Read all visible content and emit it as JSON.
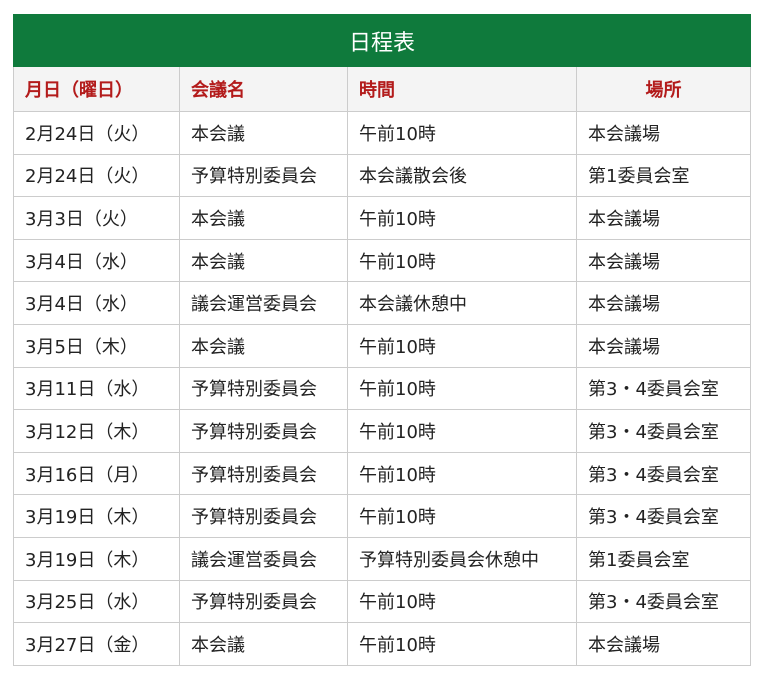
{
  "schedule": {
    "title": "日程表",
    "headers": {
      "date": "月日（曜日）",
      "meeting": "会議名",
      "time": "時間",
      "place": "場所"
    },
    "rows": [
      {
        "date": "2月24日（火）",
        "meeting": "本会議",
        "time": "午前10時",
        "place": "本会議場"
      },
      {
        "date": "2月24日（火）",
        "meeting": "予算特別委員会",
        "time": "本会議散会後",
        "place": "第1委員会室"
      },
      {
        "date": "3月3日（火）",
        "meeting": "本会議",
        "time": "午前10時",
        "place": "本会議場"
      },
      {
        "date": "3月4日（水）",
        "meeting": "本会議",
        "time": "午前10時",
        "place": "本会議場"
      },
      {
        "date": "3月4日（水）",
        "meeting": "議会運営委員会",
        "time": "本会議休憩中",
        "place": "本会議場"
      },
      {
        "date": "3月5日（木）",
        "meeting": "本会議",
        "time": "午前10時",
        "place": "本会議場"
      },
      {
        "date": "3月11日（水）",
        "meeting": "予算特別委員会",
        "time": "午前10時",
        "place": "第3・4委員会室"
      },
      {
        "date": "3月12日（木）",
        "meeting": "予算特別委員会",
        "time": "午前10時",
        "place": "第3・4委員会室"
      },
      {
        "date": "3月16日（月）",
        "meeting": "予算特別委員会",
        "time": "午前10時",
        "place": "第3・4委員会室"
      },
      {
        "date": "3月19日（木）",
        "meeting": "予算特別委員会",
        "time": "午前10時",
        "place": "第3・4委員会室"
      },
      {
        "date": "3月19日（木）",
        "meeting": "議会運営委員会",
        "time": "予算特別委員会休憩中",
        "place": "第1委員会室"
      },
      {
        "date": "3月25日（水）",
        "meeting": "予算特別委員会",
        "time": "午前10時",
        "place": "第3・4委員会室"
      },
      {
        "date": "3月27日（金）",
        "meeting": "本会議",
        "time": "午前10時",
        "place": "本会議場"
      }
    ]
  },
  "colors": {
    "title_bg": "#0f7a3c",
    "header_text": "#b31b1b",
    "header_bg": "#f4f4f4",
    "border": "#cccccc"
  }
}
